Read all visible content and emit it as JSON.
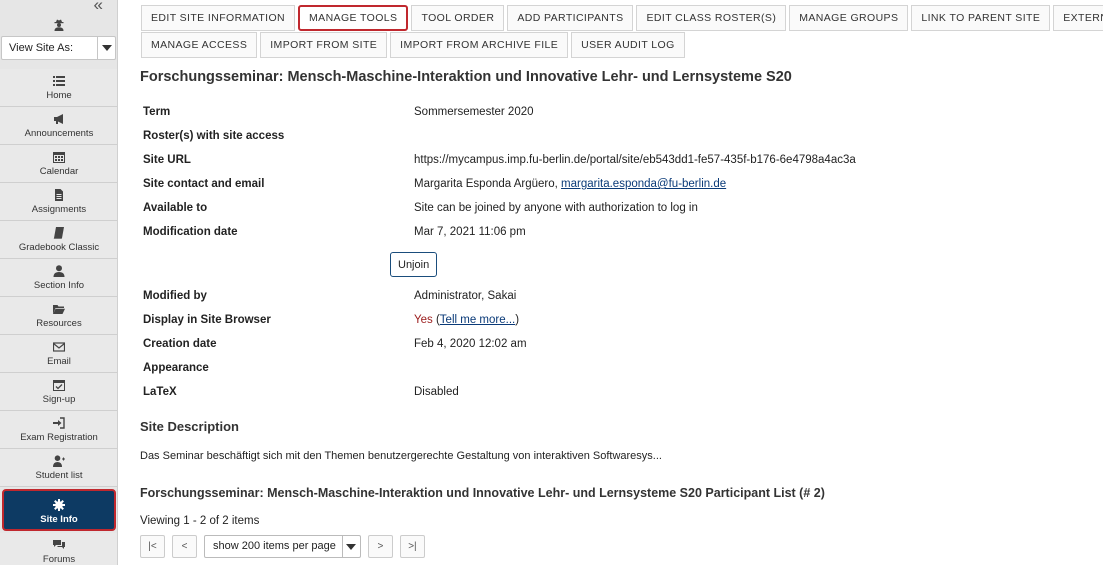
{
  "sidebar": {
    "view_site_as": "View Site As:",
    "items": [
      {
        "label": "Home",
        "icon": "list-icon"
      },
      {
        "label": "Announcements",
        "icon": "megaphone-icon"
      },
      {
        "label": "Calendar",
        "icon": "calendar-icon"
      },
      {
        "label": "Assignments",
        "icon": "file-icon"
      },
      {
        "label": "Gradebook Classic",
        "icon": "book-icon"
      },
      {
        "label": "Section Info",
        "icon": "user-icon"
      },
      {
        "label": "Resources",
        "icon": "folder-icon"
      },
      {
        "label": "Email",
        "icon": "envelope-icon"
      },
      {
        "label": "Sign-up",
        "icon": "calendar-check-icon"
      },
      {
        "label": "Exam Registration",
        "icon": "sign-in-icon"
      },
      {
        "label": "Student list",
        "icon": "user-plus-icon"
      },
      {
        "label": "Site Info",
        "icon": "gear-icon",
        "active": true
      },
      {
        "label": "Forums",
        "icon": "comments-icon"
      }
    ]
  },
  "tabs": {
    "row1": [
      "EDIT SITE INFORMATION",
      "MANAGE TOOLS",
      "TOOL ORDER",
      "ADD PARTICIPANTS",
      "EDIT CLASS ROSTER(S)",
      "MANAGE GROUPS",
      "LINK TO PARENT SITE",
      "EXTERNAL TOOLS"
    ],
    "row2": [
      "MANAGE ACCESS",
      "IMPORT FROM SITE",
      "IMPORT FROM ARCHIVE FILE",
      "USER AUDIT LOG"
    ]
  },
  "site": {
    "title": "Forschungsseminar: Mensch-Maschine-Interaktion und Innovative Lehr- und Lernsysteme S20",
    "info": {
      "term_label": "Term",
      "term_value": "Sommersemester 2020",
      "rosters_label": "Roster(s) with site access",
      "url_label": "Site URL",
      "url_value": "https://mycampus.imp.fu-berlin.de/portal/site/eb543dd1-fe57-435f-b176-6e4798a4ac3a",
      "contact_label": "Site contact and email",
      "contact_name": "Margarita Esponda Argüero, ",
      "contact_email": "margarita.esponda@fu-berlin.de",
      "available_label": "Available to",
      "available_value": "Site can be joined by anyone with authorization to log in",
      "modification_label": "Modification date",
      "modification_value": "Mar 7, 2021 11:06 pm",
      "unjoin_label": "Unjoin",
      "modified_by_label": "Modified by",
      "modified_by_value": "Administrator, Sakai",
      "display_label": "Display in Site Browser",
      "display_yes": "Yes",
      "display_open": " (",
      "display_link": "Tell me more...",
      "display_close": ")",
      "creation_label": "Creation date",
      "creation_value": "Feb 4, 2020 12:02 am",
      "appearance_label": "Appearance",
      "latex_label": "LaTeX",
      "latex_value": "Disabled"
    },
    "description_heading": "Site Description",
    "description_text": "Das Seminar beschäftigt sich mit den Themen benutzergerechte Gestaltung von interaktiven Softwaresys...",
    "participant_heading": "Forschungsseminar: Mensch-Maschine-Interaktion und Innovative Lehr- und Lernsysteme S20 Participant List (# 2)",
    "viewing_text": "Viewing 1 - 2 of 2 items",
    "pager": {
      "first": "|<",
      "prev": "<",
      "page_size": "show 200 items per page",
      "next": ">",
      "last": ">|"
    }
  },
  "colors": {
    "sidebar_bg": "#e6e6e6",
    "active_bg": "#0d3a63",
    "highlight_border": "#c0282e",
    "link": "#0a3a78"
  }
}
